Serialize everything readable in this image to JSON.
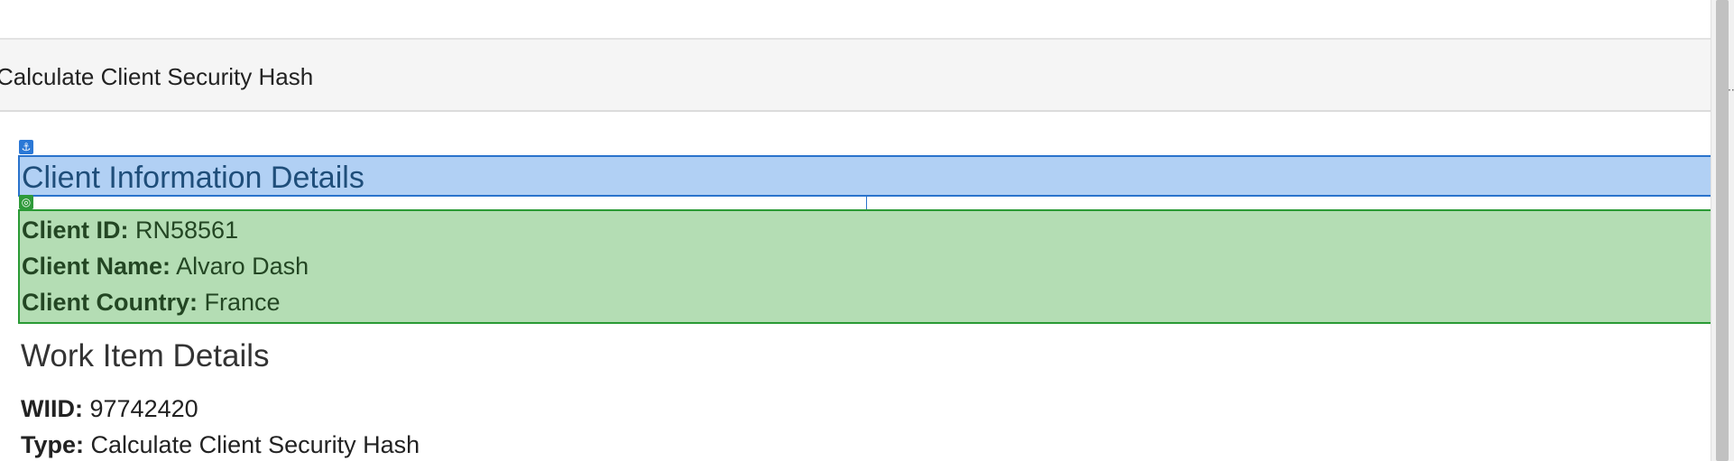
{
  "panel": {
    "title": "Calculate Client Security Hash"
  },
  "markers": {
    "anchor_icon": "anchor-icon",
    "target_icon": "target-icon",
    "anchor_glyph": "⚓",
    "target_glyph": "◎"
  },
  "client_section": {
    "heading": "Client Information Details",
    "rows": [
      {
        "label": "Client ID:",
        "value": "RN58561"
      },
      {
        "label": "Client Name:",
        "value": "Alvaro Dash"
      },
      {
        "label": "Client Country:",
        "value": "France"
      }
    ]
  },
  "work_section": {
    "heading": "Work Item Details",
    "rows": [
      {
        "label": "WIID:",
        "value": "97742420"
      },
      {
        "label": "Type:",
        "value": "Calculate Client Security Hash"
      }
    ]
  },
  "colors": {
    "heading_highlight_bg": "#b1d0f4",
    "heading_highlight_border": "#2a73cc",
    "info_highlight_bg": "#b4ddb4",
    "info_highlight_border": "#2a9a35"
  }
}
